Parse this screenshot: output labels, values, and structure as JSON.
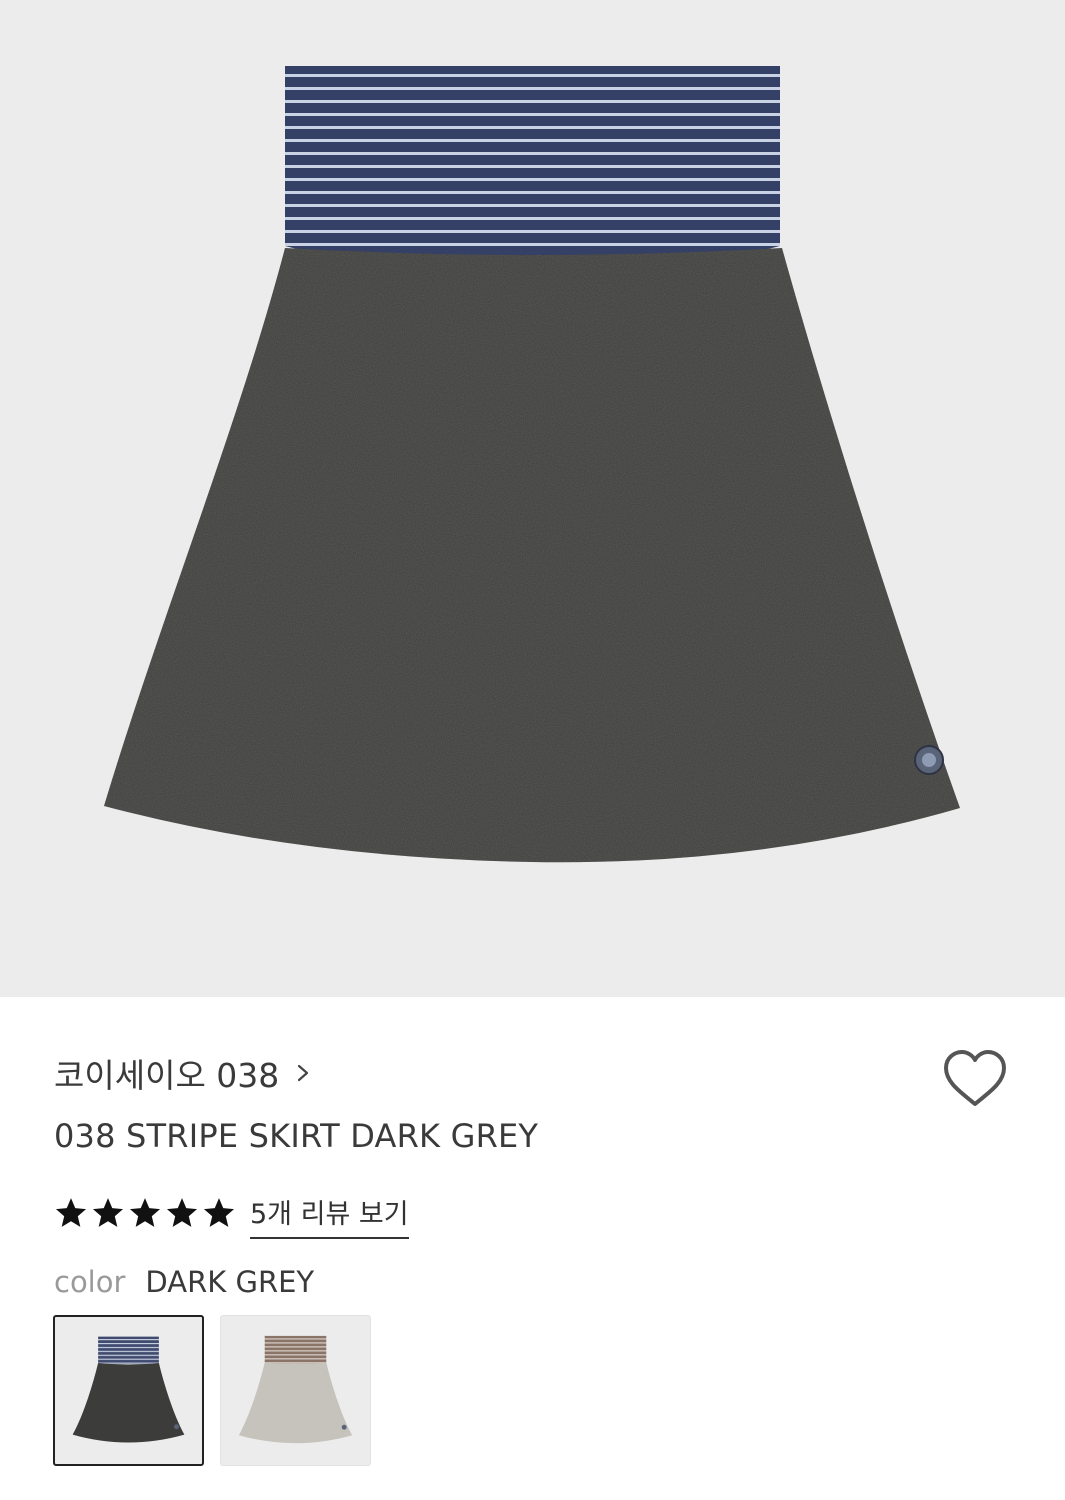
{
  "product": {
    "brand": "코이세이오 038",
    "name": "038 STRIPE SKIRT DARK GREY",
    "rating": 5,
    "review_link": "5개 리뷰 보기",
    "color_label": "color",
    "color_value": "DARK GREY"
  },
  "swatches": [
    {
      "name": "DARK GREY",
      "band": "#3f4a6e",
      "stripe": "#c7cfe0",
      "body": "#3c3c3a",
      "selected": true
    },
    {
      "name": "LIGHT GREY",
      "band": "#8a7468",
      "stripe": "#d9d1c9",
      "body": "#c6c3bd",
      "selected": false
    }
  ],
  "icons": {
    "brand_chevron": "chevron-right-icon",
    "wishlist": "heart-icon",
    "star": "star-icon"
  }
}
